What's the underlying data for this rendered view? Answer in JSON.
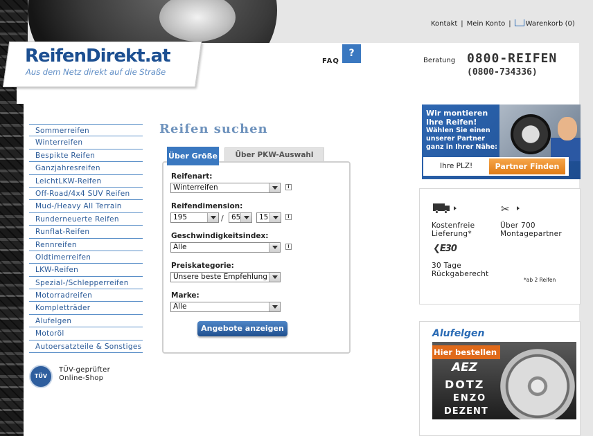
{
  "top_links": {
    "contact": "Kontakt",
    "sep": "|",
    "account": "Mein Konto",
    "cart": "Warenkorb (0)"
  },
  "header": {
    "logo_title": "ReifenDirekt.at",
    "logo_slogan": "Aus dem Netz direkt auf die Straße",
    "faq_label": "FAQ",
    "faq_icon": "?",
    "consult_label": "Beratung",
    "hotline": "0800-REIFEN",
    "hotline_number": "(0800-734336)"
  },
  "nav": {
    "items": [
      "Sommerreifen",
      "Winterreifen",
      "Bespikte Reifen",
      "Ganzjahresreifen",
      "LeichtLKW-Reifen",
      "Off-Road/4x4 SUV Reifen",
      "Mud-/Heavy All Terrain",
      "Runderneuerte Reifen",
      "Runflat-Reifen",
      "Rennreifen",
      "Oldtimerreifen",
      "LKW-Reifen",
      "Spezial-/Schlepperreifen",
      "Motorradreifen",
      "Kompletträder",
      "Alufelgen",
      "Motoröl",
      "Autoersatzteile & Sonstiges"
    ],
    "tuev_badge": "TÜV SÜD",
    "tuev_line1": "TÜV-geprüfter",
    "tuev_line2": "Online-Shop"
  },
  "search": {
    "title": "Reifen suchen",
    "tab_size": "Über Größe",
    "tab_car": "Über PKW-Auswahl",
    "tire_type_label": "Reifenart:",
    "tire_type_value": "Winterreifen",
    "dimension_label": "Reifendimension:",
    "width_value": "195",
    "dim_separator": "/",
    "ratio_value": "65",
    "rim_value": "15",
    "speed_label": "Geschwindigkeitsindex:",
    "speed_value": "Alle",
    "price_label": "Preiskategorie:",
    "price_value": "Unsere beste Empfehlung",
    "brand_label": "Marke:",
    "brand_value": "Alle",
    "info_icon": "i",
    "submit_label": "Angebote anzeigen"
  },
  "montage": {
    "headline_1": "Wir montieren",
    "headline_2": "Ihre Reifen!",
    "text_1": "Wählen Sie einen",
    "text_2": "unserer Partner",
    "text_3": "ganz in Ihrer Nähe:",
    "plz_placeholder": "Ihre PLZ!",
    "button": "Partner Finden"
  },
  "benefits": {
    "free_delivery_1": "Kostenfreie",
    "free_delivery_2": "Lieferung*",
    "partners_1": "Über 700",
    "partners_2": "Montagepartner",
    "e30_icon": "E30",
    "return_1": "30 Tage",
    "return_2": "Rückgaberecht",
    "footnote": "*ab 2 Reifen"
  },
  "alufelgen": {
    "title": "Alufelgen",
    "banner_text": "Hier bestellen",
    "brands": [
      "AEZ",
      "DOTZ",
      "ENZO",
      "DEZENT"
    ]
  }
}
